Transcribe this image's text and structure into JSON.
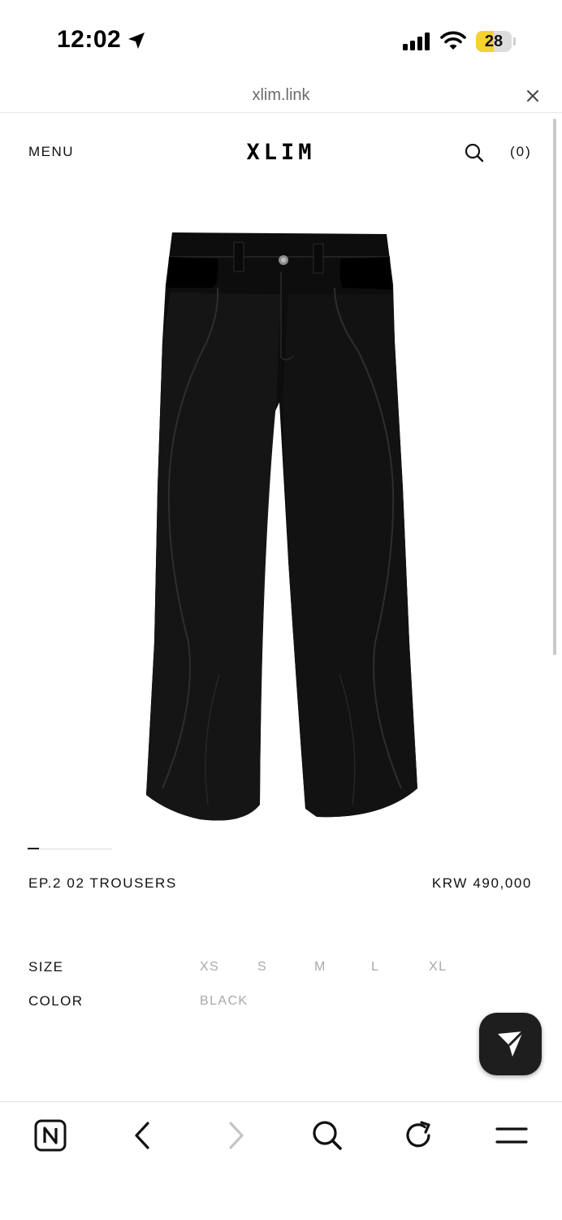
{
  "status_bar": {
    "time": "12:02",
    "battery": "28",
    "battery_level": 0.28,
    "battery_color": "#f6d22c"
  },
  "browser": {
    "url": "xlim.link"
  },
  "header": {
    "menu": "MENU",
    "logo": "XLIM",
    "cart": "(0)"
  },
  "product": {
    "name": "EP.2 02 TROUSERS",
    "price": "KRW 490,000",
    "image_index": 1
  },
  "options": {
    "size_label": "SIZE",
    "sizes": [
      "XS",
      "S",
      "M",
      "L",
      "XL"
    ],
    "color_label": "COLOR",
    "colors": [
      "BLACK"
    ]
  },
  "icons": {
    "status": [
      "location-arrow-icon",
      "cellular-signal-icon",
      "wifi-icon"
    ],
    "header": [
      "search-icon"
    ],
    "fab": "send-icon",
    "toolbar": [
      "n-logo-icon",
      "back-arrow-icon",
      "forward-arrow-icon",
      "search-icon",
      "reload-icon",
      "menu-icon"
    ]
  }
}
